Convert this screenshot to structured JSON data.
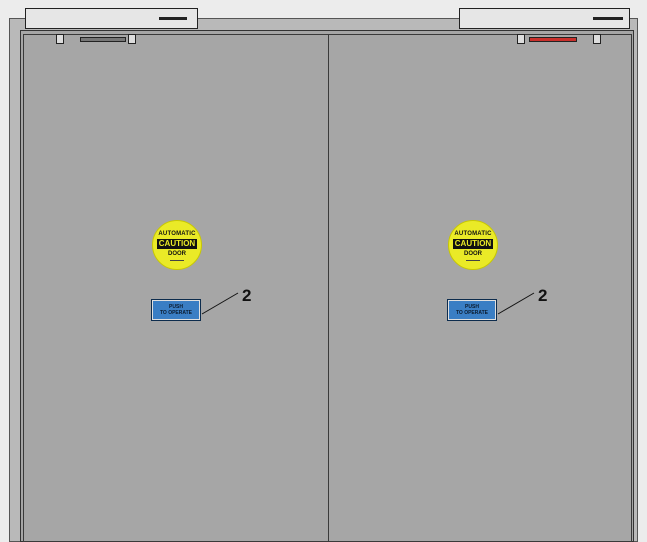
{
  "decal": {
    "line1": "AUTOMATIC",
    "line2": "CAUTION",
    "line3": "DOOR"
  },
  "push_plate": {
    "line1": "PUSH",
    "line2": "TO OPERATE"
  },
  "callouts": {
    "left": "2",
    "right": "2"
  },
  "colors": {
    "door": "#a6a6a6",
    "decal": "#eaea27",
    "push_plate": "#3a7ec4",
    "closer_indicator": "#c9302c"
  }
}
